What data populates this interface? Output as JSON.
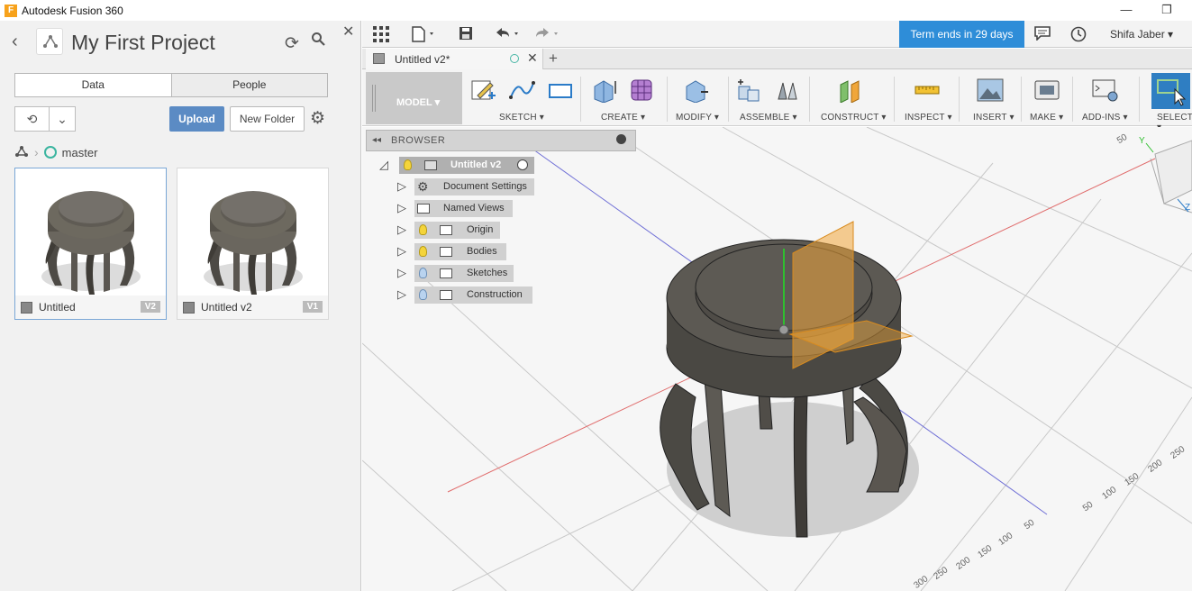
{
  "window": {
    "title": "Autodesk Fusion 360",
    "app_icon_letter": "F"
  },
  "left_panel": {
    "project_title": "My First Project",
    "tabs": [
      "Data",
      "People"
    ],
    "upload_label": "Upload",
    "new_folder_label": "New Folder",
    "branch": "master",
    "files": [
      {
        "name": "Untitled",
        "version": "V2"
      },
      {
        "name": "Untitled v2",
        "version": "V1"
      }
    ]
  },
  "topbar": {
    "term_badge": "Term ends in 29 days",
    "user": "Shifa Jaber"
  },
  "doc_tab": {
    "label": "Untitled v2*"
  },
  "toolbar": {
    "workspace": "MODEL",
    "groups": [
      "SKETCH",
      "CREATE",
      "MODIFY",
      "ASSEMBLE",
      "CONSTRUCT",
      "INSPECT",
      "INSERT",
      "MAKE",
      "ADD-INS",
      "SELECT"
    ]
  },
  "browser": {
    "title": "BROWSER",
    "root": "Untitled v2",
    "items": [
      "Document Settings",
      "Named Views",
      "Origin",
      "Bodies",
      "Sketches",
      "Construction"
    ]
  },
  "viewcube": {
    "axis_labels": [
      "Y",
      "Z"
    ]
  },
  "grid_labels": {
    "right_edge": [
      "50",
      "100",
      "150",
      "200",
      "250"
    ],
    "bottom_edge": [
      "50",
      "100",
      "150",
      "200",
      "250",
      "300"
    ],
    "top": "50"
  },
  "colors": {
    "accent_blue": "#2e8dd8",
    "upload_blue": "#5b8bc4",
    "branch_teal": "#3bb5a0",
    "model_gray": "#c9c9c9",
    "construction_orange": "#f0a63a"
  }
}
